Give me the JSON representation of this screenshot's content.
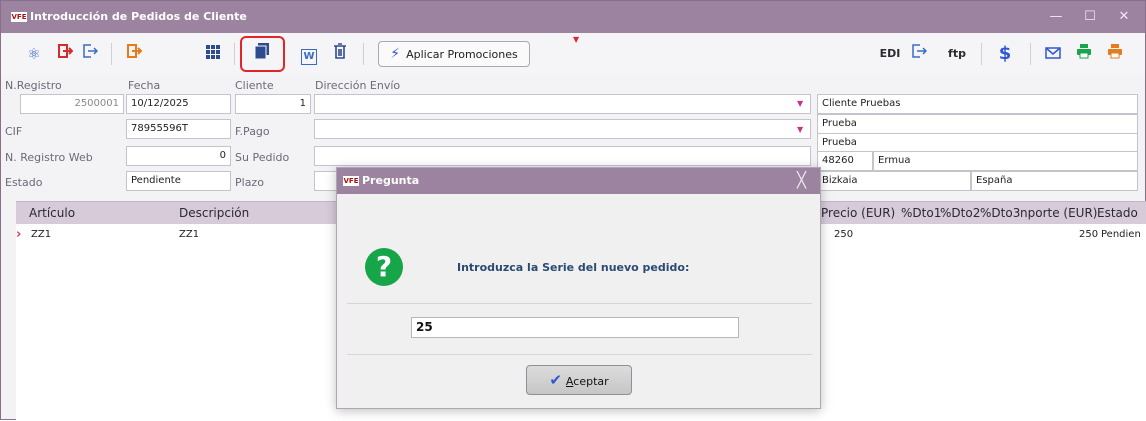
{
  "window": {
    "logo": "VFE",
    "title": "Introducción de Pedidos de Cliente",
    "controls": [
      "—",
      "☐",
      "✕"
    ]
  },
  "toolbar": {
    "promotions_label": "Aplicar Promociones",
    "edi_label": "EDI",
    "ftp_label": "ftp",
    "dollar_label": "$",
    "word_label": "W",
    "icons": [
      "atom-icon",
      "exit-red-icon",
      "export-icon",
      "exit-orange-icon",
      "grid-icon",
      "copy-icon",
      "word-icon",
      "trash-icon",
      "lightning-icon",
      "export-icon",
      "dollar-icon",
      "mail-icon",
      "print-icon",
      "print-orange-icon"
    ]
  },
  "form": {
    "n_registro_label": "N.Registro",
    "n_registro": "2500001",
    "fecha_label": "Fecha",
    "fecha": "10/12/2025",
    "cliente_label": "Cliente",
    "cliente": "1",
    "direccion_label": "Dirección Envío",
    "direccion": "",
    "cif_label": "CIF",
    "cif": "78955596T",
    "fpago_label": "F.Pago",
    "fpago": "",
    "registro_web_label": "N. Registro Web",
    "registro_web": "0",
    "su_pedido_label": "Su Pedido",
    "su_pedido": "",
    "estado_label": "Estado",
    "estado": "Pendiente",
    "plazo_label": "Plazo",
    "plazo": ""
  },
  "address": {
    "name": "Cliente Pruebas",
    "line1": "Prueba",
    "line2": "Prueba",
    "cp": "48260",
    "city": "Ermua",
    "province": "Bizkaia",
    "country": "España"
  },
  "grid": {
    "headers": {
      "articulo": "Artículo",
      "descripcion": "Descripción",
      "precio": "Precio (EUR)",
      "dto1": "%Dto1",
      "dto2": "%Dto2",
      "dto3": "%Dto3",
      "importe": "nporte (EUR)",
      "estado": "Estado"
    },
    "rows": [
      {
        "articulo": "ZZ1",
        "descripcion": "ZZ1",
        "precio": "250",
        "importe": "250",
        "estado": "Pendien"
      }
    ],
    "current_row_marker": "›"
  },
  "dialog": {
    "logo": "VFE",
    "title": "Pregunta",
    "close": "╳",
    "icon_glyph": "?",
    "question": "Introduzca la Serie del nuevo pedido:",
    "input_value": "25",
    "ok_mnemonic": "A",
    "ok_rest": "ceptar"
  },
  "colors": {
    "titlebar": "#9c84a0",
    "grid_header": "#d7cbd9",
    "highlight": "#e0262a",
    "question_icon": "#17a54a",
    "accent_blue": "#2f56d6"
  }
}
